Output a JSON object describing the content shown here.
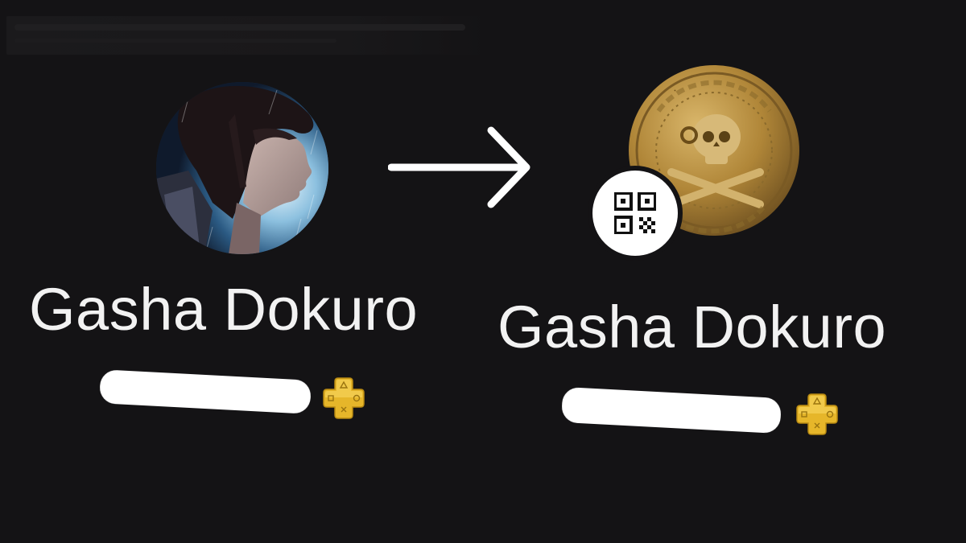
{
  "before": {
    "display_name": "Gasha Dokuro",
    "online_id": "[redacted]",
    "membership_icon": "playstation-plus-icon"
  },
  "after": {
    "display_name": "Gasha Dokuro",
    "online_id": "[redacted]",
    "membership_icon": "playstation-plus-icon",
    "avatar_badge_icon": "qr-code-icon"
  },
  "transition_icon": "arrow-right-icon",
  "colors": {
    "background": "#141315",
    "name_text": "#f2f2f2",
    "ps_plus": "#e8b928",
    "coin": "#b48a3c"
  }
}
